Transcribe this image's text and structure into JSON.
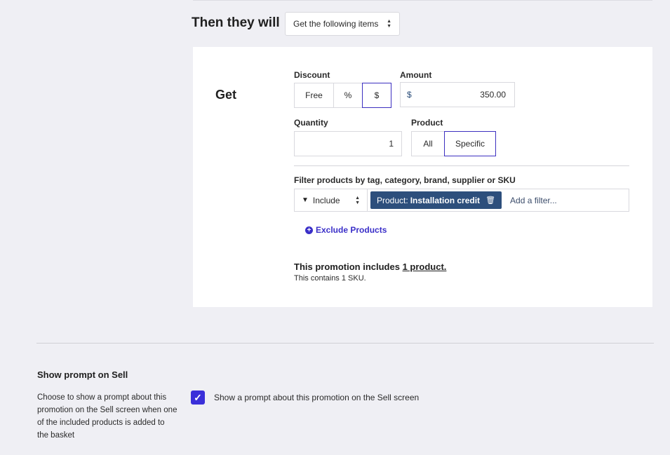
{
  "action": {
    "label": "Then they will",
    "select_value": "Get the following items"
  },
  "get": {
    "title": "Get",
    "discount": {
      "label": "Discount",
      "options": [
        "Free",
        "%",
        "$"
      ],
      "selected": "$"
    },
    "amount": {
      "label": "Amount",
      "currency": "$",
      "value": "350.00"
    },
    "quantity": {
      "label": "Quantity",
      "value": "1"
    },
    "product": {
      "label": "Product",
      "options": [
        "All",
        "Specific"
      ],
      "selected": "Specific"
    },
    "filter": {
      "label": "Filter products by tag, category, brand, supplier or SKU",
      "mode": "Include",
      "chip_prefix": "Product:",
      "chip_value": "Installation credit",
      "add_placeholder": "Add a filter..."
    },
    "exclude_label": "Exclude Products",
    "summary": {
      "prefix": "This promotion includes",
      "link": "1 product.",
      "sub": "This contains 1 SKU."
    }
  },
  "prompt": {
    "title": "Show prompt on Sell",
    "description": "Choose to show a prompt about this promotion on the Sell screen when one of the included products is added to the basket",
    "checkbox_label": "Show a prompt about this promotion on the Sell screen",
    "checked": true
  },
  "colors": {
    "accent": "#3a2fd9",
    "chip": "#2d4f7c"
  }
}
